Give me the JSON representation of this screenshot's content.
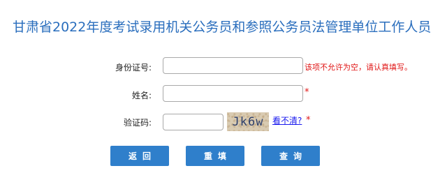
{
  "page": {
    "title": "甘肃省2022年度考试录用机关公务员和参照公务员法管理单位工作人员"
  },
  "form": {
    "id_label": "身份证号:",
    "id_value": "",
    "id_error": "该项不允许为空，请认真填写。",
    "name_label": "姓名:",
    "name_value": "",
    "name_required": "*",
    "captcha_label": "验证码:",
    "captcha_value": "",
    "captcha_text": "Jk6w",
    "refresh_link": "看不清?",
    "captcha_required": "*"
  },
  "buttons": {
    "back": "返回",
    "reset": "重填",
    "query": "查询"
  },
  "colors": {
    "title": "#2a6ebd",
    "button": "#2f7fcb",
    "error": "#e01515"
  }
}
